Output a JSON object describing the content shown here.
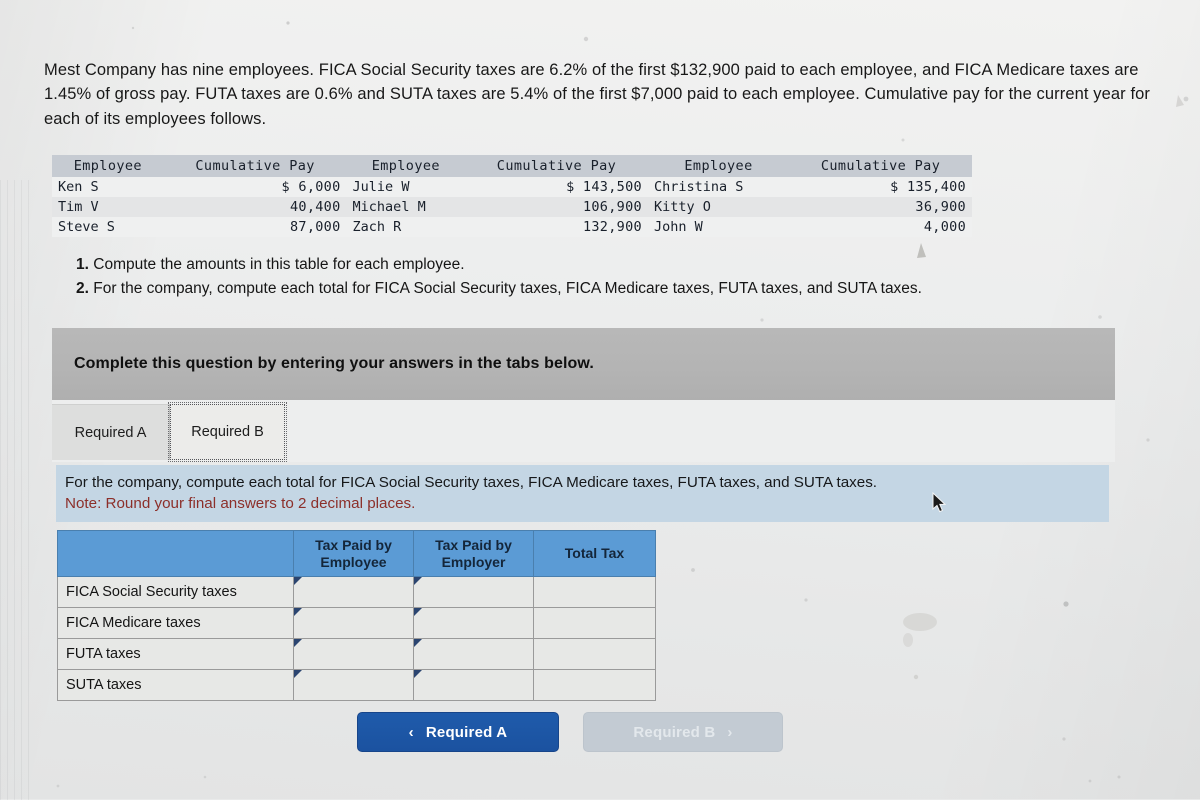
{
  "intro": {
    "paragraph": "Mest Company has nine employees. FICA Social Security taxes are 6.2% of the first $132,900 paid to each employee, and FICA Medicare taxes are 1.45% of gross pay. FUTA taxes are 0.6% and SUTA taxes are 5.4% of the first $7,000 paid to each employee. Cumulative pay for the current year for each of its employees follows."
  },
  "employee_table": {
    "headers": [
      "Employee",
      "Cumulative Pay",
      "Employee",
      "Cumulative Pay",
      "Employee",
      "Cumulative Pay"
    ],
    "rows": [
      [
        "Ken S",
        "$ 6,000",
        "Julie W",
        "$ 143,500",
        "Christina S",
        "$ 135,400"
      ],
      [
        "Tim V",
        "40,400",
        "Michael M",
        "106,900",
        "Kitty O",
        "36,900"
      ],
      [
        "Steve S",
        "87,000",
        "Zach R",
        "132,900",
        "John W",
        "4,000"
      ]
    ]
  },
  "requirements": [
    {
      "num": "1.",
      "text": "Compute the amounts in this table for each employee."
    },
    {
      "num": "2.",
      "text": "For the company, compute each total for FICA Social Security taxes, FICA Medicare taxes, FUTA taxes, and SUTA taxes."
    }
  ],
  "banner": {
    "text": "Complete this question by entering your answers in the tabs below."
  },
  "tabs": [
    {
      "label": "Required A",
      "selected": false
    },
    {
      "label": "Required B",
      "selected": true
    }
  ],
  "instruction": {
    "line1": "For the company, compute each total for FICA Social Security taxes, FICA Medicare taxes, FUTA taxes, and SUTA taxes.",
    "line2": "Note: Round your final answers to 2 decimal places."
  },
  "answer_table": {
    "headers": {
      "corner": "",
      "employee": "Tax Paid by Employee",
      "employer": "Tax Paid by Employer",
      "total": "Total Tax"
    },
    "header_lines": {
      "employee_l1": "Tax Paid by",
      "employee_l2": "Employee",
      "employer_l1": "Tax Paid by",
      "employer_l2": "Employer",
      "total": "Total Tax"
    },
    "rows": [
      {
        "label": "FICA Social Security taxes",
        "employee": "",
        "employer": "",
        "total": ""
      },
      {
        "label": "FICA Medicare taxes",
        "employee": "",
        "employer": "",
        "total": ""
      },
      {
        "label": "FUTA taxes",
        "employee": "",
        "employer": "",
        "total": ""
      },
      {
        "label": "SUTA taxes",
        "employee": "",
        "employer": "",
        "total": ""
      }
    ]
  },
  "nav": {
    "prev_label": "Required A",
    "prev_chevron": "‹",
    "next_label": "Required B",
    "next_chevron": "›"
  },
  "colors": {
    "header_blue": "#5b9bd5",
    "instruction_blue": "#c4d6e4",
    "banner_gray": "#b4b4b4",
    "active_button_blue": "#1f5bab",
    "disabled_button_gray": "#c3cbd3",
    "note_red": "#8c2f2a"
  }
}
